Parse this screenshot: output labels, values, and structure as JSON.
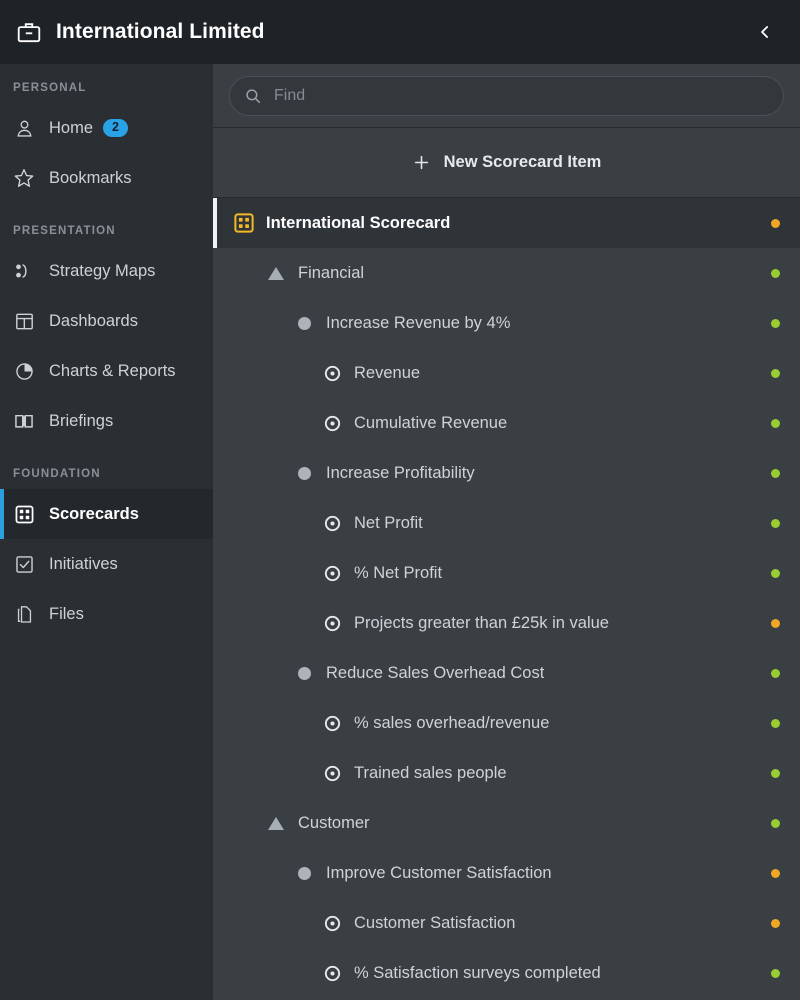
{
  "header": {
    "brand_icon": "briefcase-icon",
    "title": "International Limited",
    "collapse_icon": "chevron-left-icon"
  },
  "sidebar": {
    "groups": [
      {
        "label": "PERSONAL",
        "items": [
          {
            "label": "Home",
            "icon": "user-icon",
            "badge": "2",
            "active": false
          },
          {
            "label": "Bookmarks",
            "icon": "star-icon",
            "badge": "",
            "active": false
          }
        ]
      },
      {
        "label": "PRESENTATION",
        "items": [
          {
            "label": "Strategy Maps",
            "icon": "strategy-map-icon",
            "badge": "",
            "active": false
          },
          {
            "label": "Dashboards",
            "icon": "dashboard-icon",
            "badge": "",
            "active": false
          },
          {
            "label": "Charts & Reports",
            "icon": "pie-chart-icon",
            "badge": "",
            "active": false
          },
          {
            "label": "Briefings",
            "icon": "book-icon",
            "badge": "",
            "active": false
          }
        ]
      },
      {
        "label": "FOUNDATION",
        "items": [
          {
            "label": "Scorecards",
            "icon": "scorecard-icon",
            "badge": "",
            "active": true
          },
          {
            "label": "Initiatives",
            "icon": "checkbox-icon",
            "badge": "",
            "active": false
          },
          {
            "label": "Files",
            "icon": "file-icon",
            "badge": "",
            "active": false
          }
        ]
      }
    ]
  },
  "search": {
    "placeholder": "Find",
    "value": "",
    "icon": "search-icon"
  },
  "toolbar": {
    "new_item_label": "New Scorecard Item",
    "plus_icon": "plus-icon"
  },
  "colors": {
    "accent_blue": "#2b9fe0",
    "badge_blue": "#29a3e8",
    "status_green": "#9acd32",
    "status_amber": "#f0a724",
    "scorecard_gold": "#f2b827"
  },
  "tree": {
    "rows": [
      {
        "label": "International Scorecard",
        "icon": "scorecard-icon",
        "type": "scorecard",
        "indent": 0,
        "status": "amber",
        "selected": true
      },
      {
        "label": "Financial",
        "icon": "triangle-up-icon",
        "type": "perspective",
        "indent": 1,
        "status": "green",
        "selected": false
      },
      {
        "label": "Increase Revenue by 4%",
        "icon": "objective-bullet-icon",
        "type": "objective",
        "indent": 2,
        "status": "green",
        "selected": false
      },
      {
        "label": "Revenue",
        "icon": "measure-target-icon",
        "type": "measure",
        "indent": 3,
        "status": "green",
        "selected": false
      },
      {
        "label": "Cumulative Revenue",
        "icon": "measure-target-icon",
        "type": "measure",
        "indent": 3,
        "status": "green",
        "selected": false
      },
      {
        "label": "Increase Profitability",
        "icon": "objective-bullet-icon",
        "type": "objective",
        "indent": 2,
        "status": "green",
        "selected": false
      },
      {
        "label": "Net Profit",
        "icon": "measure-target-icon",
        "type": "measure",
        "indent": 3,
        "status": "green",
        "selected": false
      },
      {
        "label": "% Net Profit",
        "icon": "measure-target-icon",
        "type": "measure",
        "indent": 3,
        "status": "green",
        "selected": false
      },
      {
        "label": "Projects greater than £25k in value",
        "icon": "measure-target-icon",
        "type": "measure",
        "indent": 3,
        "status": "amber",
        "selected": false
      },
      {
        "label": "Reduce Sales Overhead Cost",
        "icon": "objective-bullet-icon",
        "type": "objective",
        "indent": 2,
        "status": "green",
        "selected": false
      },
      {
        "label": "% sales overhead/revenue",
        "icon": "measure-target-icon",
        "type": "measure",
        "indent": 3,
        "status": "green",
        "selected": false
      },
      {
        "label": "Trained sales people",
        "icon": "measure-target-icon",
        "type": "measure",
        "indent": 3,
        "status": "green",
        "selected": false
      },
      {
        "label": "Customer",
        "icon": "triangle-up-icon",
        "type": "perspective",
        "indent": 1,
        "status": "green",
        "selected": false
      },
      {
        "label": "Improve Customer Satisfaction",
        "icon": "objective-bullet-icon",
        "type": "objective",
        "indent": 2,
        "status": "amber",
        "selected": false
      },
      {
        "label": "Customer Satisfaction",
        "icon": "measure-target-icon",
        "type": "measure",
        "indent": 3,
        "status": "amber",
        "selected": false
      },
      {
        "label": "% Satisfaction surveys completed",
        "icon": "measure-target-icon",
        "type": "measure",
        "indent": 3,
        "status": "green",
        "selected": false
      }
    ]
  }
}
